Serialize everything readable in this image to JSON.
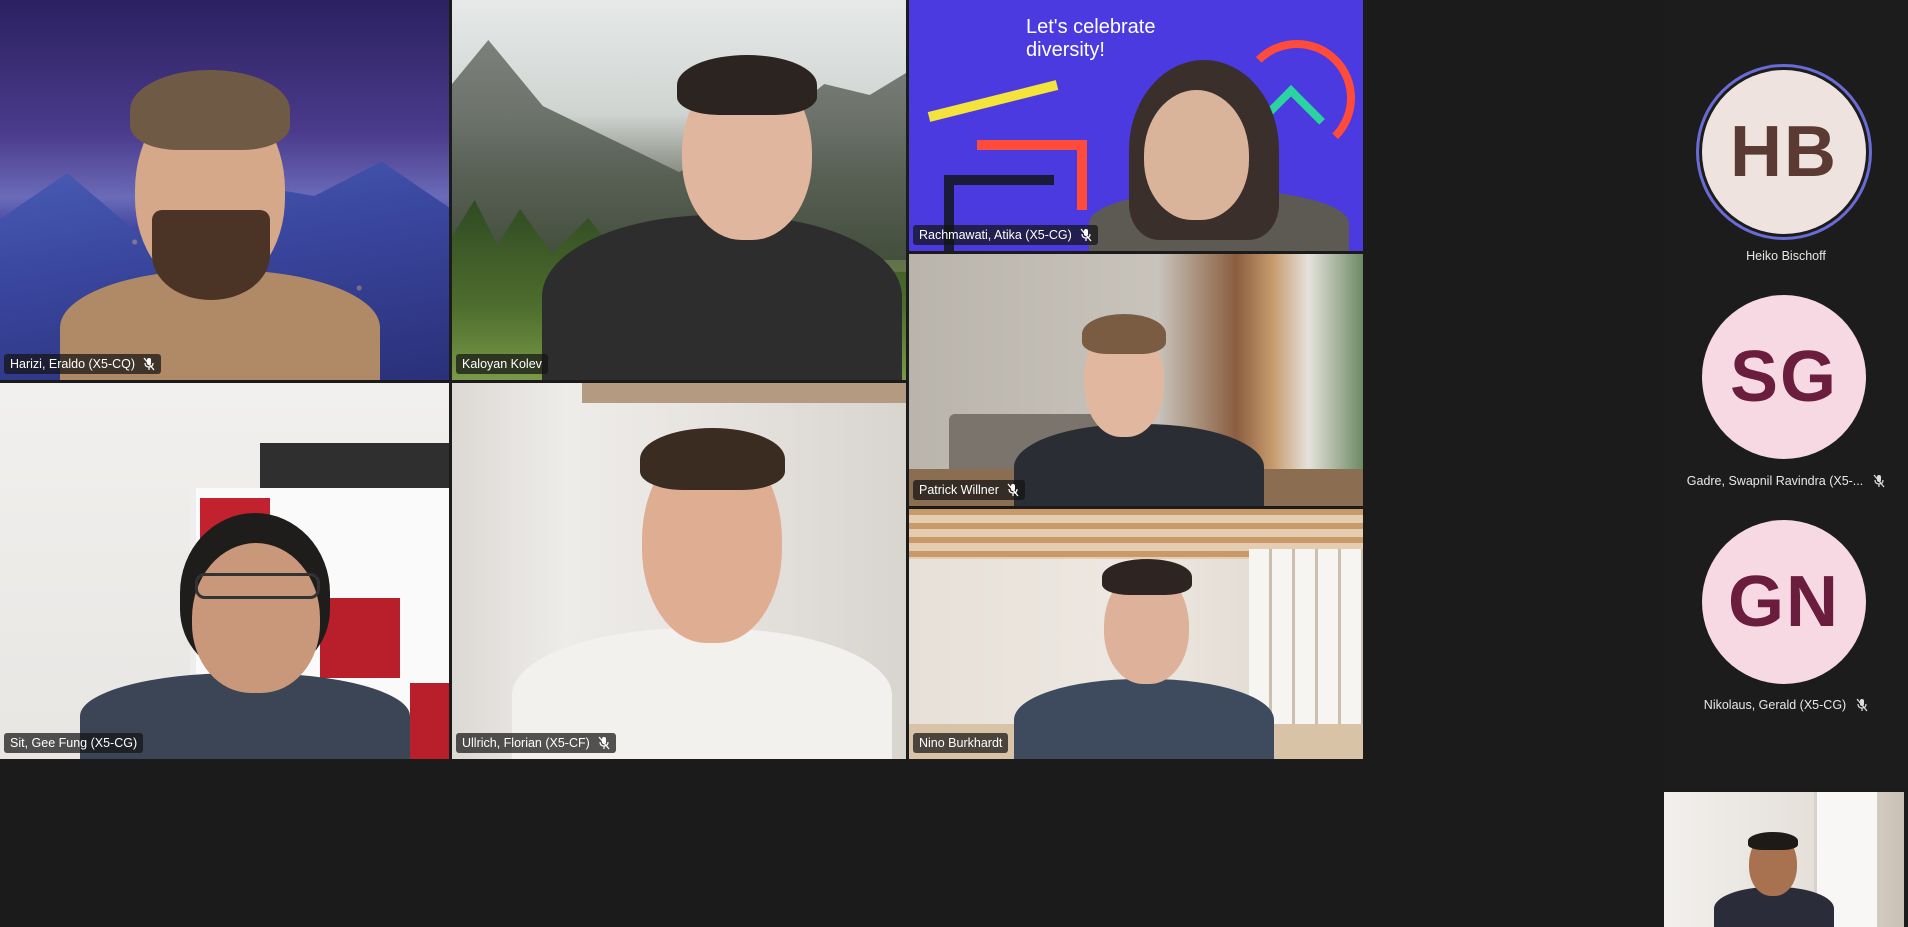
{
  "participants": [
    {
      "name": "Harizi, Eraldo (X5-CQ)",
      "muted": true,
      "background": "purple-night-mountains"
    },
    {
      "name": "Kaloyan Kolev",
      "muted": false,
      "background": "mountain-valley"
    },
    {
      "name": "Rachmawati, Atika (X5-CG)",
      "muted": true,
      "background": "lets-celebrate-diversity-banner",
      "banner_text": "Let's celebrate diversity!"
    },
    {
      "name": "Patrick Willner",
      "muted": true,
      "background": "concrete-living-room"
    },
    {
      "name": "Sit, Gee Fung (X5-CG)",
      "muted": false,
      "background": "white-room-shelves"
    },
    {
      "name": "Ullrich, Florian (X5-CF)",
      "muted": true,
      "background": "white-wall"
    },
    {
      "name": "Nino Burkhardt",
      "muted": false,
      "background": "wooden-loft"
    }
  ],
  "roster": [
    {
      "initials": "HB",
      "name": "Heiko Bischoff",
      "muted": false,
      "speaking": true,
      "avatar_bg": "#efe3df",
      "avatar_fg": "#5a3a33"
    },
    {
      "initials": "SG",
      "name": "Gadre, Swapnil Ravindra (X5-...",
      "muted": true,
      "speaking": false,
      "avatar_bg": "#f6d9e2",
      "avatar_fg": "#6a1d3c"
    },
    {
      "initials": "GN",
      "name": "Nikolaus, Gerald (X5-CG)",
      "muted": true,
      "speaking": false,
      "avatar_bg": "#f6d9e2",
      "avatar_fg": "#6a1d3c"
    }
  ],
  "self_view": {
    "label": ""
  },
  "colors": {
    "background": "#1b1b1b",
    "speaking_ring": "#6b6bd6",
    "name_tag_bg": "rgba(20,20,20,0.72)"
  },
  "icons": {
    "mic_off": "mic-off-icon"
  }
}
